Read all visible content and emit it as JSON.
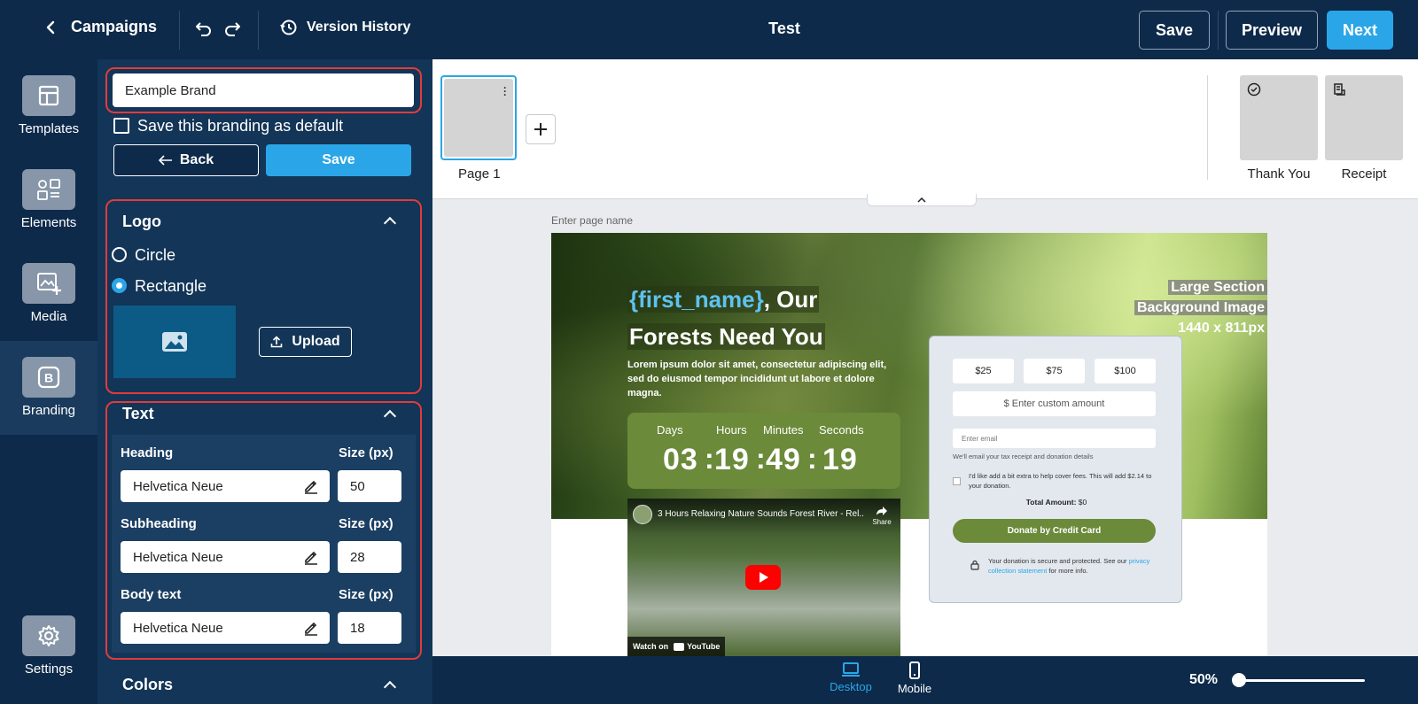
{
  "topbar": {
    "back_label": "Campaigns",
    "version_history_label": "Version History",
    "title": "Test",
    "save_label": "Save",
    "preview_label": "Preview",
    "next_label": "Next"
  },
  "rail": {
    "items": [
      {
        "label": "Templates",
        "icon": "layout-icon"
      },
      {
        "label": "Elements",
        "icon": "elements-icon"
      },
      {
        "label": "Media",
        "icon": "image-add-icon"
      },
      {
        "label": "Branding",
        "icon": "branding-b-icon",
        "active": true
      },
      {
        "label": "Settings",
        "icon": "gear-icon"
      }
    ]
  },
  "branding": {
    "brand_name": "Example Brand",
    "save_default_label": "Save this branding as default",
    "back_label": "Back",
    "save_label": "Save",
    "logo": {
      "title": "Logo",
      "options": [
        "Circle",
        "Rectangle"
      ],
      "selected": "Rectangle",
      "upload_label": "Upload"
    },
    "text": {
      "title": "Text",
      "size_label": "Size (px)",
      "rows": [
        {
          "label": "Heading",
          "font": "Helvetica Neue",
          "size": "50"
        },
        {
          "label": "Subheading",
          "font": "Helvetica Neue",
          "size": "28"
        },
        {
          "label": "Body text",
          "font": "Helvetica Neue",
          "size": "18"
        }
      ]
    },
    "colors_title": "Colors"
  },
  "pages": {
    "page1_label": "Page 1",
    "thank_you_label": "Thank You",
    "receipt_label": "Receipt"
  },
  "canvas": {
    "page_name_placeholder": "Enter page name",
    "hero": {
      "heading_token": "{first_name}",
      "heading_rest": ", Our",
      "heading_line2": "Forests Need You",
      "body": "Lorem ipsum dolor sit amet, consectetur adipiscing elit, sed do eiusmod tempor incididunt ut labore et dolore magna.",
      "bg_note_line1": "Large Section",
      "bg_note_line2": "Background Image",
      "bg_note_line3": "1440 x 811px"
    },
    "countdown": {
      "labels": [
        "Days",
        "Hours",
        "Minutes",
        "Seconds"
      ],
      "values": [
        "03",
        "19",
        "49",
        "19"
      ]
    },
    "video": {
      "title": "3 Hours Relaxing Nature Sounds Forest River - Rel...",
      "share_label": "Share",
      "watch_on": "Watch on",
      "youtube": "YouTube"
    },
    "donation": {
      "amounts": [
        "$25",
        "$75",
        "$100"
      ],
      "custom_placeholder": "$ Enter custom amount",
      "email_placeholder": "Enter email",
      "email_hint": "We'll email your tax receipt and donation details",
      "cover_fees": "I'd like add a bit extra to help cover fees. This will add $2.14 to your donation.",
      "total_label": "Total Amount:",
      "total_value": "$0",
      "donate_button": "Donate by Credit Card",
      "secure_text": "Your donation is secure and protected. See our",
      "privacy_link": "privacy collection statement",
      "secure_suffix": "for more info."
    }
  },
  "bottombar": {
    "desktop_label": "Desktop",
    "mobile_label": "Mobile",
    "zoom": "50%",
    "zoom_fraction": 0.0
  },
  "colors": {
    "navy": "#0d2a4a",
    "panel": "#133557",
    "accent": "#2aa6e8",
    "highlight_red": "#e23b3b",
    "green": "#6b8a3a"
  }
}
